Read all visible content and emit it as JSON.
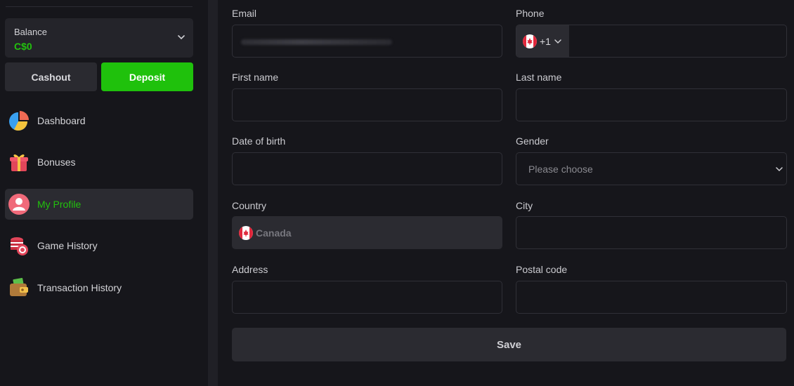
{
  "sidebar": {
    "balance": {
      "label": "Balance",
      "value": "C$0",
      "chevron_icon": "chevron-down-icon"
    },
    "buttons": {
      "cashout_label": "Cashout",
      "deposit_label": "Deposit"
    },
    "items": [
      {
        "label": "Dashboard",
        "icon": "pie-chart-icon",
        "active": false
      },
      {
        "label": "Bonuses",
        "icon": "gift-icon",
        "active": false
      },
      {
        "label": "My Profile",
        "icon": "user-avatar-icon",
        "active": true
      },
      {
        "label": "Game History",
        "icon": "casino-chips-icon",
        "active": false
      },
      {
        "label": "Transaction History",
        "icon": "wallet-icon",
        "active": false
      }
    ]
  },
  "form": {
    "email": {
      "label": "Email",
      "value_redacted": true
    },
    "phone": {
      "label": "Phone",
      "country_code": "+1",
      "flag_icon": "canada-flag-icon",
      "value": ""
    },
    "first_name": {
      "label": "First name",
      "value": ""
    },
    "last_name": {
      "label": "Last name",
      "value": ""
    },
    "date_of_birth": {
      "label": "Date of birth",
      "value": ""
    },
    "gender": {
      "label": "Gender",
      "placeholder": "Please choose"
    },
    "country": {
      "label": "Country",
      "value": "Canada",
      "flag_icon": "canada-flag-icon"
    },
    "city": {
      "label": "City",
      "value": ""
    },
    "address": {
      "label": "Address",
      "value": ""
    },
    "postal_code": {
      "label": "Postal code",
      "value": ""
    },
    "save_label": "Save"
  },
  "colors": {
    "background": "#16161b",
    "panel": "#2b2b31",
    "accent_green": "#1fc10c",
    "active_text": "#22c20d",
    "field_border": "#303037"
  }
}
